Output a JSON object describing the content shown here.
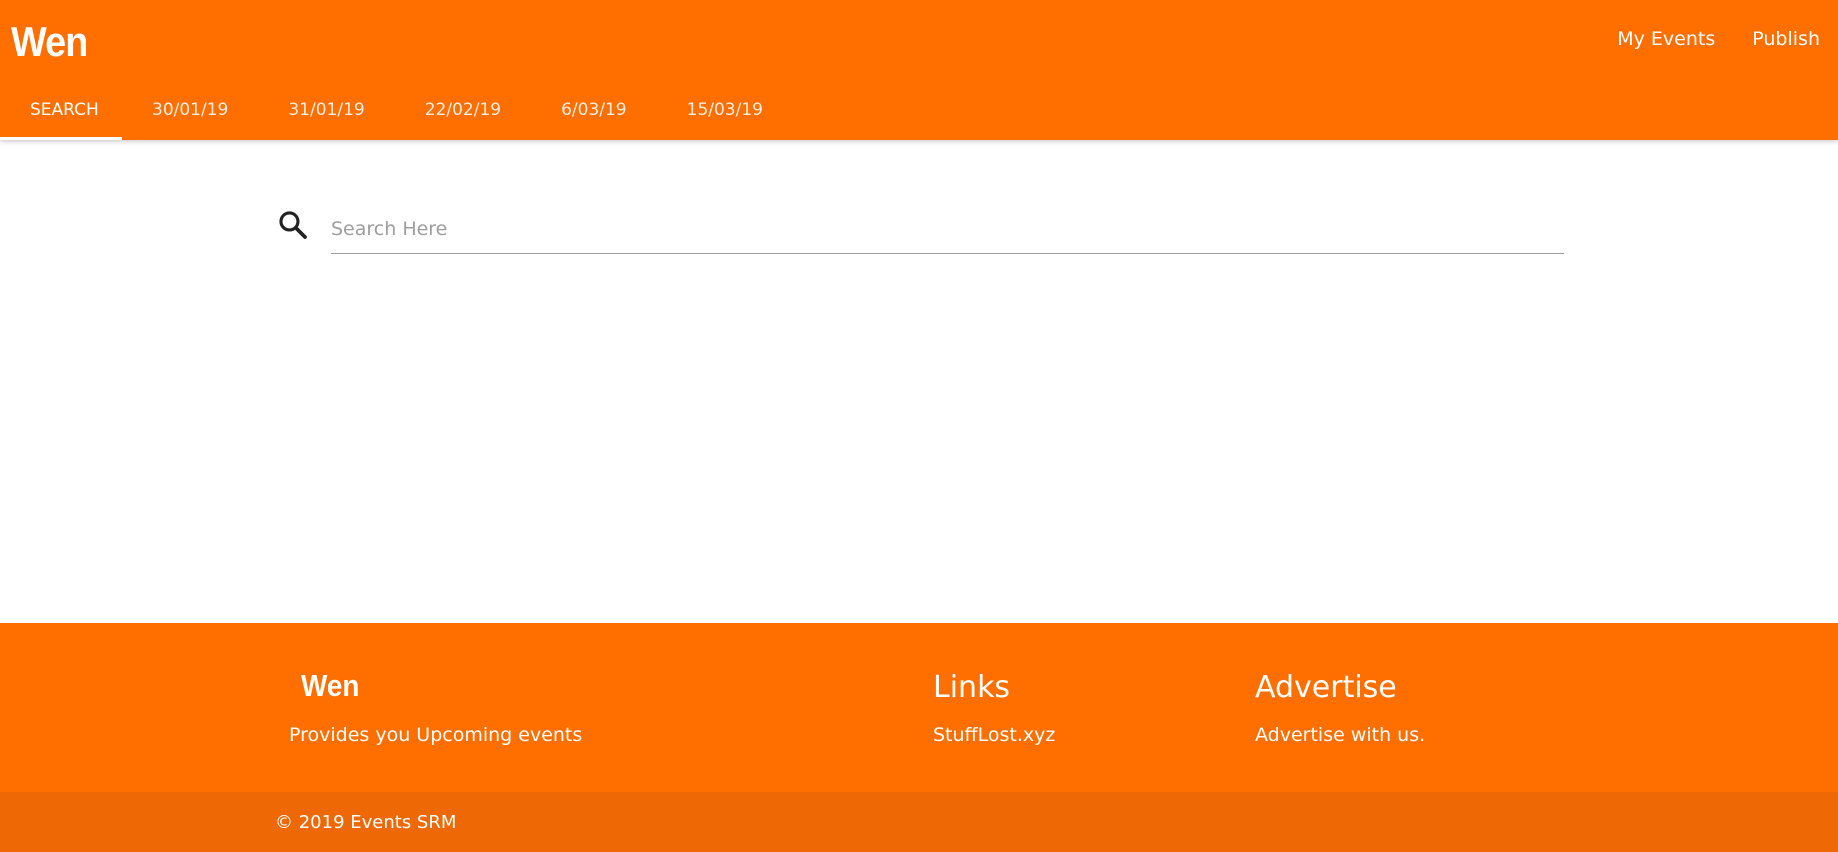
{
  "header": {
    "brand": "Wen",
    "nav": [
      {
        "label": "My Events"
      },
      {
        "label": "Publish"
      }
    ]
  },
  "tabs": [
    {
      "label": "SEARCH",
      "active": true
    },
    {
      "label": "30/01/19"
    },
    {
      "label": "31/01/19"
    },
    {
      "label": "22/02/19"
    },
    {
      "label": "6/03/19"
    },
    {
      "label": "15/03/19"
    }
  ],
  "search": {
    "icon": "search-icon",
    "placeholder": "Search Here",
    "value": ""
  },
  "footer": {
    "brand": "Wen",
    "description": "Provides you Upcoming events",
    "links": {
      "title": "Links",
      "items": [
        {
          "label": "StuffLost.xyz"
        }
      ]
    },
    "advertise": {
      "title": "Advertise",
      "items": [
        {
          "label": "Advertise with us."
        }
      ]
    },
    "copyright": "© 2019 Events SRM"
  },
  "colors": {
    "primary": "#ff6f00",
    "footer_bottom": "#ee6906",
    "text_on_primary": "#ffffff",
    "placeholder": "#9e9e9e"
  }
}
